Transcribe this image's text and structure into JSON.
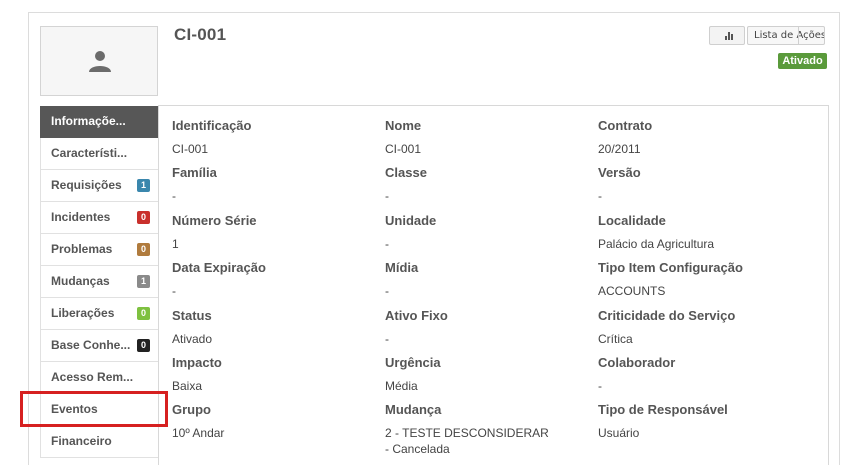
{
  "header": {
    "ci_title": "CI-001",
    "actions_label": "Lista de Ações",
    "status_badge": "Ativado",
    "status_color": "#5a9a3b"
  },
  "sidebar": {
    "items": [
      {
        "label": "Informaçõe...",
        "active": true
      },
      {
        "label": "Característi..."
      },
      {
        "label": "Requisições",
        "count": "1",
        "count_color": "#3a87ad"
      },
      {
        "label": "Incidentes",
        "count": "0",
        "count_color": "#c9302c"
      },
      {
        "label": "Problemas",
        "count": "0",
        "count_color": "#b07b3d"
      },
      {
        "label": "Mudanças",
        "count": "1",
        "count_color": "#8a8a8a"
      },
      {
        "label": "Liberações",
        "count": "0",
        "count_color": "#7ec140"
      },
      {
        "label": "Base Conhe...",
        "count": "0",
        "count_color": "#222222"
      },
      {
        "label": "Acesso Rem..."
      },
      {
        "label": "Eventos"
      },
      {
        "label": "Financeiro"
      }
    ]
  },
  "fields": [
    {
      "label": "Identificação",
      "value": "CI-001"
    },
    {
      "label": "Nome",
      "value": "CI-001"
    },
    {
      "label": "Contrato",
      "value": "20/2011"
    },
    {
      "label": "Família",
      "value": "-"
    },
    {
      "label": "Classe",
      "value": "-"
    },
    {
      "label": "Versão",
      "value": "-"
    },
    {
      "label": "Número Série",
      "value": "1"
    },
    {
      "label": "Unidade",
      "value": "-"
    },
    {
      "label": "Localidade",
      "value": "Palácio da Agricultura"
    },
    {
      "label": "Data Expiração",
      "value": "-"
    },
    {
      "label": "Mídia",
      "value": "-"
    },
    {
      "label": "Tipo Item Configuração",
      "value": "ACCOUNTS"
    },
    {
      "label": "Status",
      "value": "Ativado"
    },
    {
      "label": "Ativo Fixo",
      "value": "-"
    },
    {
      "label": "Criticidade do Serviço",
      "value": "Crítica"
    },
    {
      "label": "Impacto",
      "value": "Baixa"
    },
    {
      "label": "Urgência",
      "value": "Média"
    },
    {
      "label": "Colaborador",
      "value": "-"
    },
    {
      "label": "Grupo",
      "value": "10º Andar"
    },
    {
      "label": "Mudança",
      "value": "2 - TESTE DESCONSIDERAR - Cancelada"
    },
    {
      "label": "Tipo de Responsável",
      "value": "Usuário"
    }
  ],
  "icons": {
    "avatar": "user-icon",
    "chart_button": "bar-chart-icon"
  }
}
